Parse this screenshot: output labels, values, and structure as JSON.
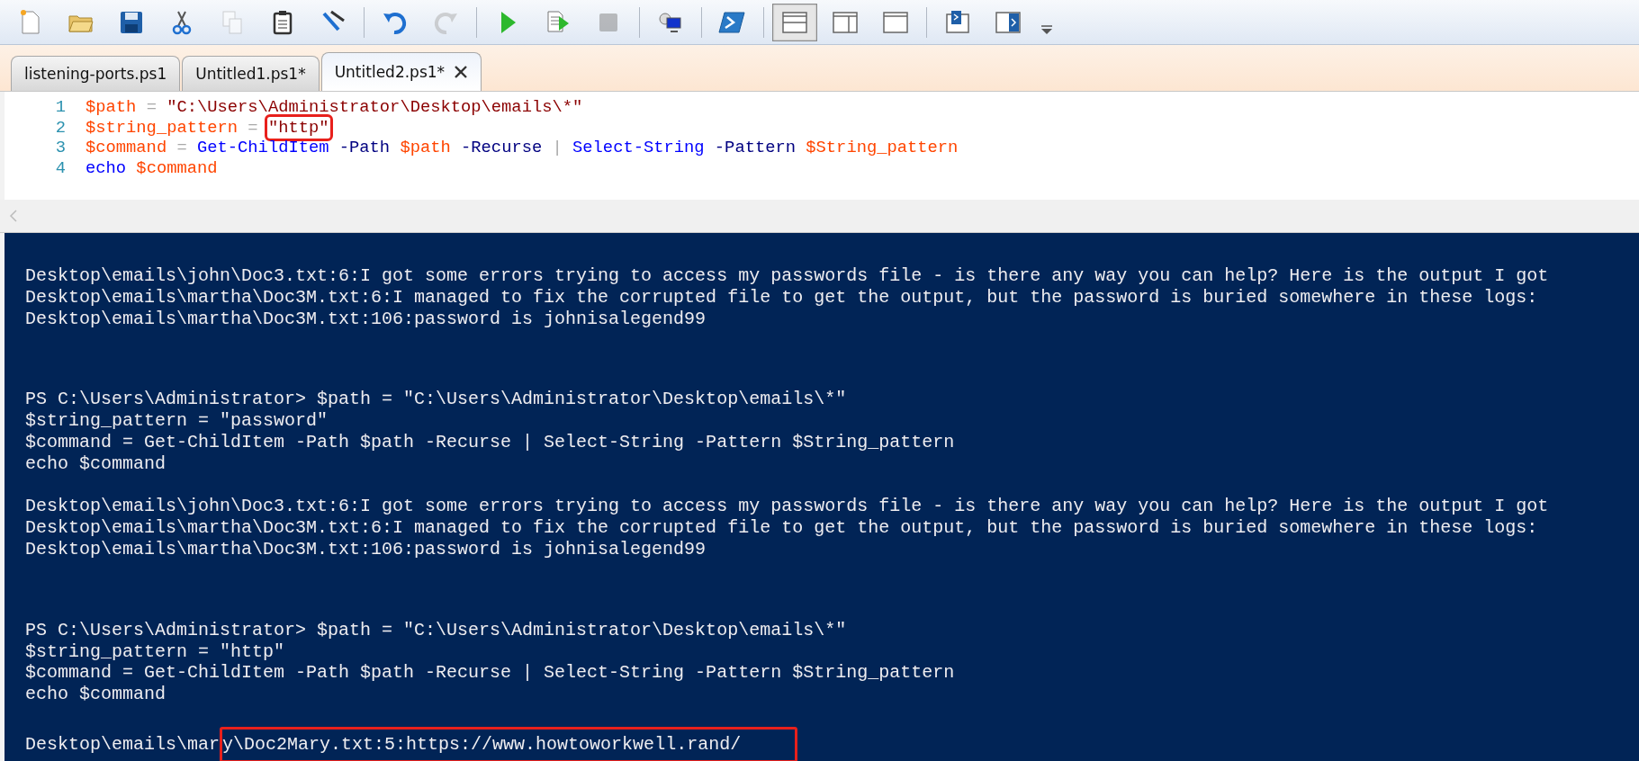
{
  "toolbar": {
    "items": [
      {
        "kind": "new",
        "disabled": false
      },
      {
        "kind": "open",
        "disabled": false
      },
      {
        "kind": "save",
        "disabled": false
      },
      {
        "kind": "cut",
        "disabled": false
      },
      {
        "kind": "copy",
        "disabled": true
      },
      {
        "kind": "paste",
        "disabled": false
      },
      {
        "kind": "clear",
        "disabled": false
      },
      {
        "kind": "separator"
      },
      {
        "kind": "undo",
        "disabled": false
      },
      {
        "kind": "redo",
        "disabled": true
      },
      {
        "kind": "separator"
      },
      {
        "kind": "run",
        "disabled": false
      },
      {
        "kind": "run-selection",
        "disabled": false
      },
      {
        "kind": "stop",
        "disabled": true
      },
      {
        "kind": "separator"
      },
      {
        "kind": "remote",
        "disabled": false
      },
      {
        "kind": "separator"
      },
      {
        "kind": "powershell",
        "disabled": false
      },
      {
        "kind": "separator"
      },
      {
        "kind": "layout-top",
        "selected": true
      },
      {
        "kind": "layout-right",
        "selected": false
      },
      {
        "kind": "layout-max",
        "selected": false
      },
      {
        "kind": "separator"
      },
      {
        "kind": "show-script",
        "disabled": false
      },
      {
        "kind": "show-console",
        "disabled": false
      },
      {
        "kind": "overflow",
        "disabled": false
      }
    ]
  },
  "tabs": [
    {
      "label": "listening-ports.ps1",
      "selected": false
    },
    {
      "label": "Untitled1.ps1*",
      "selected": false
    },
    {
      "label": "Untitled2.ps1*",
      "selected": true
    }
  ],
  "editor": {
    "lines": [
      {
        "number": "1",
        "tokens": [
          {
            "kind": "variable",
            "text": "$path"
          },
          {
            "kind": "operator",
            "text": " = "
          },
          {
            "kind": "string",
            "text": "\"C:\\Users\\Administrator\\Desktop\\emails\\*\""
          }
        ]
      },
      {
        "number": "2",
        "tokens": [
          {
            "kind": "variable",
            "text": "$string_pattern"
          },
          {
            "kind": "operator",
            "text": " = "
          },
          {
            "kind": "string",
            "text": "\"http\"",
            "highlighted": true
          }
        ]
      },
      {
        "number": "3",
        "tokens": [
          {
            "kind": "variable",
            "text": "$command"
          },
          {
            "kind": "operator",
            "text": " = "
          },
          {
            "kind": "command",
            "text": "Get-ChildItem"
          },
          {
            "kind": "parameter",
            "text": " -Path "
          },
          {
            "kind": "variable",
            "text": "$path"
          },
          {
            "kind": "parameter",
            "text": " -Recurse "
          },
          {
            "kind": "operator",
            "text": "| "
          },
          {
            "kind": "command",
            "text": "Select-String"
          },
          {
            "kind": "parameter",
            "text": " -Pattern "
          },
          {
            "kind": "variable",
            "text": "$String_pattern"
          }
        ]
      },
      {
        "number": "4",
        "tokens": [
          {
            "kind": "command",
            "text": "echo "
          },
          {
            "kind": "variable",
            "text": "$command"
          }
        ]
      }
    ]
  },
  "console": {
    "blocks": [
      {
        "kind": "output",
        "lines": [
          {
            "segments": [
              {
                "text": "Desktop\\emails\\john\\Doc3.txt:6:I got some errors trying to access my passwords file - is there any way you can help? Here is the output I got"
              }
            ]
          },
          {
            "segments": [
              {
                "text": "Desktop\\emails\\martha\\Doc3M.txt:6:I managed to fix the corrupted file to get the output, but the password is buried somewhere in these logs:"
              }
            ]
          },
          {
            "segments": [
              {
                "text": "Desktop\\emails\\martha\\Doc3M.txt:106:password is johnisalegend99"
              }
            ]
          }
        ]
      },
      {
        "kind": "command",
        "lines": [
          {
            "segments": [
              {
                "text": "PS C:\\Users\\Administrator> $path = \"C:\\Users\\Administrator\\Desktop\\emails\\*\""
              }
            ]
          },
          {
            "segments": [
              {
                "text": "$string_pattern = \"password\""
              }
            ]
          },
          {
            "segments": [
              {
                "text": "$command = Get-ChildItem -Path $path -Recurse | Select-String -Pattern $String_pattern"
              }
            ]
          },
          {
            "segments": [
              {
                "text": "echo $command"
              }
            ]
          }
        ]
      },
      {
        "kind": "output",
        "lines": [
          {
            "segments": [
              {
                "text": "Desktop\\emails\\john\\Doc3.txt:6:I got some errors trying to access my passwords file - is there any way you can help? Here is the output I got"
              }
            ]
          },
          {
            "segments": [
              {
                "text": "Desktop\\emails\\martha\\Doc3M.txt:6:I managed to fix the corrupted file to get the output, but the password is buried somewhere in these logs:"
              }
            ]
          },
          {
            "segments": [
              {
                "text": "Desktop\\emails\\martha\\Doc3M.txt:106:password is johnisalegend99"
              }
            ]
          }
        ]
      },
      {
        "kind": "command",
        "lines": [
          {
            "segments": [
              {
                "text": "PS C:\\Users\\Administrator> $path = \"C:\\Users\\Administrator\\Desktop\\emails\\*\""
              }
            ]
          },
          {
            "segments": [
              {
                "text": "$string_pattern = \"http\""
              }
            ]
          },
          {
            "segments": [
              {
                "text": "$command = Get-ChildItem -Path $path -Recurse | Select-String -Pattern $String_pattern"
              }
            ]
          },
          {
            "segments": [
              {
                "text": "echo $command"
              }
            ]
          }
        ]
      },
      {
        "kind": "output",
        "lines": [
          {
            "segments": [
              {
                "text": "Desktop\\emails\\mar"
              },
              {
                "text": "y\\Doc2Mary.txt:5:https://www.howtoworkwell.rand/",
                "highlighted": true
              }
            ]
          }
        ]
      }
    ]
  }
}
